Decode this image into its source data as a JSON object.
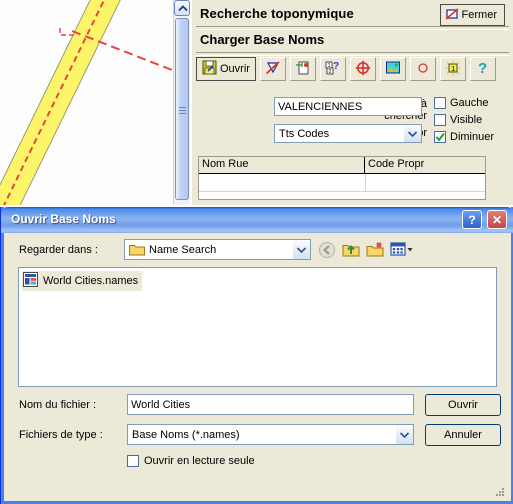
{
  "map": {
    "name": "map-canvas",
    "road_color": "#fdf569",
    "route_color": "#e8453c",
    "scrollbar": {
      "up_arrow": "scroll-up-arrow"
    }
  },
  "panel": {
    "title": "Recherche toponymique",
    "close_label": "Fermer",
    "subtitle": "Charger Base Noms",
    "toolbar": [
      {
        "name": "open",
        "label": "Ouvrir",
        "icon": "floppy-disk-open-icon"
      },
      {
        "name": "delete",
        "label": "",
        "icon": "delete-crossed-icon"
      },
      {
        "name": "export",
        "label": "",
        "icon": "document-arrow-icon"
      },
      {
        "name": "query",
        "label": "",
        "icon": "numbered-question-icon"
      },
      {
        "name": "target",
        "label": "",
        "icon": "crosshair-target-icon"
      },
      {
        "name": "image",
        "label": "",
        "icon": "picture-icon"
      },
      {
        "name": "circle",
        "label": "",
        "icon": "circle-outline-icon"
      },
      {
        "name": "layer-one",
        "label": "",
        "icon": "layer-one-icon"
      },
      {
        "name": "help",
        "label": "",
        "icon": "question-mark-icon"
      }
    ],
    "fields": {
      "search_name_label_line1": "Nom à",
      "search_name_label_line2": "chercher",
      "search_name_value": "VALENCIENNES",
      "code_label": "Code Propr",
      "code_value": "Tts Codes"
    },
    "checkboxes": [
      {
        "label": "Gauche",
        "checked": false
      },
      {
        "label": "Visible",
        "checked": false
      },
      {
        "label": "Diminuer",
        "checked": true
      }
    ],
    "grid": {
      "columns": [
        "Nom Rue",
        "Code Propr"
      ],
      "rows": [
        [
          "",
          ""
        ]
      ]
    }
  },
  "dialog": {
    "title": "Ouvrir Base Noms",
    "help_button": "?",
    "close_button": "✕",
    "lookin_label": "Regarder dans :",
    "lookin_value": "Name Search",
    "nav_icons": [
      {
        "name": "back-icon",
        "state": "disabled"
      },
      {
        "name": "up-folder-icon",
        "state": "enabled"
      },
      {
        "name": "new-folder-icon",
        "state": "enabled"
      },
      {
        "name": "views-icon",
        "state": "enabled"
      }
    ],
    "files": [
      {
        "name": "World Cities.names",
        "icon": "names-file-icon",
        "selected": true
      }
    ],
    "filename_label": "Nom du fichier :",
    "filename_value": "World Cities",
    "filetype_label": "Fichiers de type :",
    "filetype_value": "Base Noms (*.names)",
    "open_button": "Ouvrir",
    "cancel_button": "Annuler",
    "readonly_label": "Ouvrir en lecture seule",
    "readonly_checked": false
  }
}
